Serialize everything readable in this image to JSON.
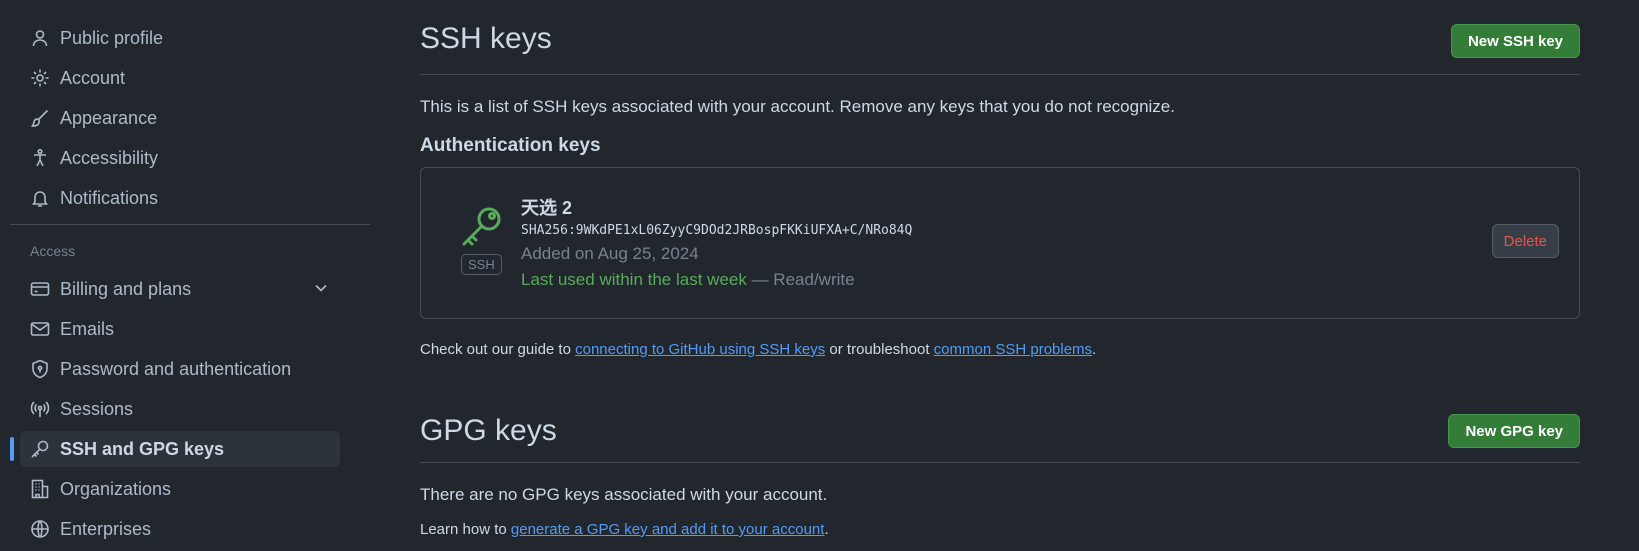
{
  "sidebar": {
    "items_top": [
      {
        "label": "Public profile",
        "icon": "person-icon"
      },
      {
        "label": "Account",
        "icon": "gear-icon"
      },
      {
        "label": "Appearance",
        "icon": "paintbrush-icon"
      },
      {
        "label": "Accessibility",
        "icon": "accessibility-icon"
      },
      {
        "label": "Notifications",
        "icon": "bell-icon"
      }
    ],
    "access_label": "Access",
    "items_access": [
      {
        "label": "Billing and plans",
        "icon": "credit-card-icon"
      },
      {
        "label": "Emails",
        "icon": "mail-icon"
      },
      {
        "label": "Password and authentication",
        "icon": "shield-lock-icon"
      },
      {
        "label": "Sessions",
        "icon": "broadcast-icon"
      },
      {
        "label": "SSH and GPG keys",
        "icon": "key-icon"
      },
      {
        "label": "Organizations",
        "icon": "organization-icon"
      },
      {
        "label": "Enterprises",
        "icon": "globe-icon"
      }
    ]
  },
  "ssh": {
    "title": "SSH keys",
    "new_button": "New SSH key",
    "description": "This is a list of SSH keys associated with your account. Remove any keys that you do not recognize.",
    "auth_heading": "Authentication keys",
    "key": {
      "badge": "SSH",
      "title": "天选 2",
      "fingerprint": "SHA256:9WKdPE1xL06ZyyC9DOd2JRBospFKKiUFXA+C/NRo84Q",
      "added": "Added on Aug 25, 2024",
      "last_used": "Last used within the last week",
      "access": " — Read/write",
      "delete_button": "Delete"
    },
    "guide": {
      "prefix": "Check out our guide to ",
      "link1": "connecting to GitHub using SSH keys",
      "middle": " or troubleshoot ",
      "link2": "common SSH problems",
      "suffix": "."
    }
  },
  "gpg": {
    "title": "GPG keys",
    "new_button": "New GPG key",
    "empty": "There are no GPG keys associated with your account.",
    "learn_prefix": "Learn how to ",
    "learn_link": "generate a GPG key and add it to your account",
    "learn_suffix": "."
  },
  "colors": {
    "background": "#22272e",
    "accent_green": "#347d39",
    "link": "#539bf5",
    "danger": "#e5534b"
  }
}
